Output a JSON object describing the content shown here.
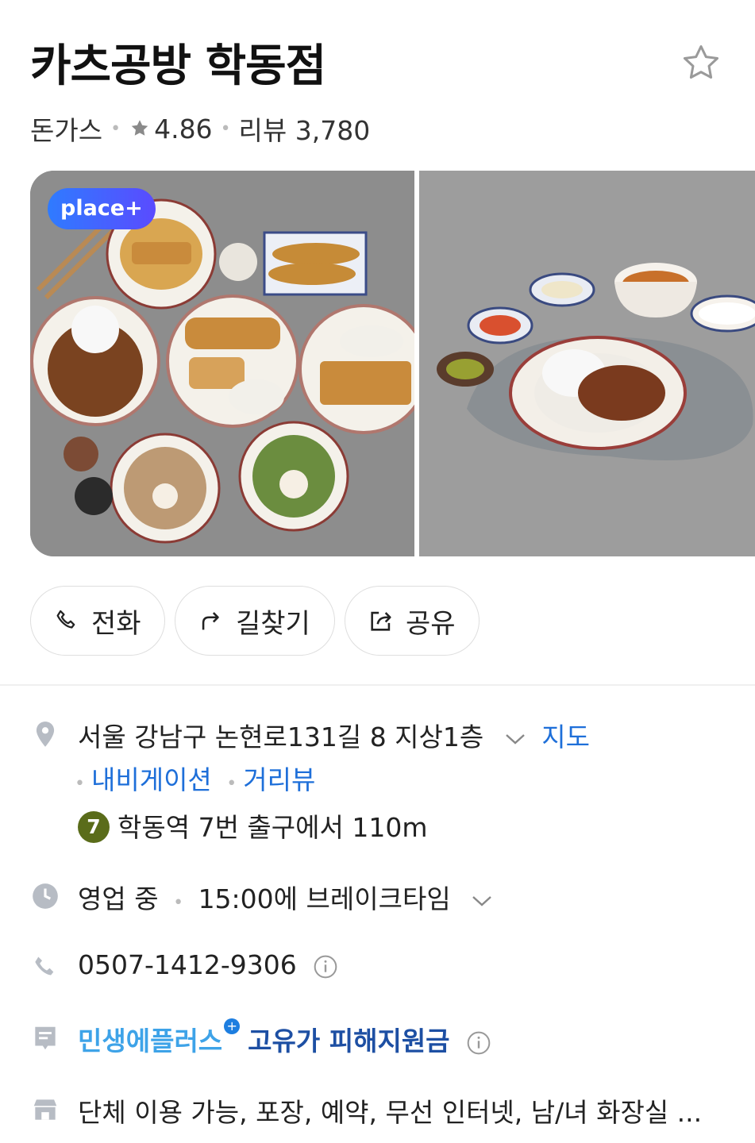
{
  "place": {
    "name": "카츠공방 학동점",
    "category": "돈가스",
    "rating": "4.86",
    "reviews": "리뷰 3,780"
  },
  "gallery": {
    "badge": "place+"
  },
  "actions": {
    "call": "전화",
    "route": "길찾기",
    "share": "공유"
  },
  "address": {
    "text": "서울 강남구 논현로131길 8 지상1층",
    "map_link": "지도",
    "navigation_link": "내비게이션",
    "streetview_link": "거리뷰"
  },
  "subway": {
    "line": "7",
    "text": "학동역 7번 출구에서 110m"
  },
  "hours": {
    "status": "영업 중",
    "detail": "15:00에 브레이크타임"
  },
  "phone": {
    "number": "0507-1412-9306"
  },
  "promo": {
    "label1": "민생에플러스",
    "plus": "+",
    "label2": "고유가 피해지원금"
  },
  "amenities": {
    "text": "단체 이용 가능, 포장, 예약, 무선 인터넷, 남/녀 화장실 ..."
  },
  "colors": {
    "link": "#1e6fd9",
    "subway_line7": "#5a6c1a",
    "badge_gradient_start": "#2f7bff",
    "badge_gradient_end": "#5a4bff"
  }
}
